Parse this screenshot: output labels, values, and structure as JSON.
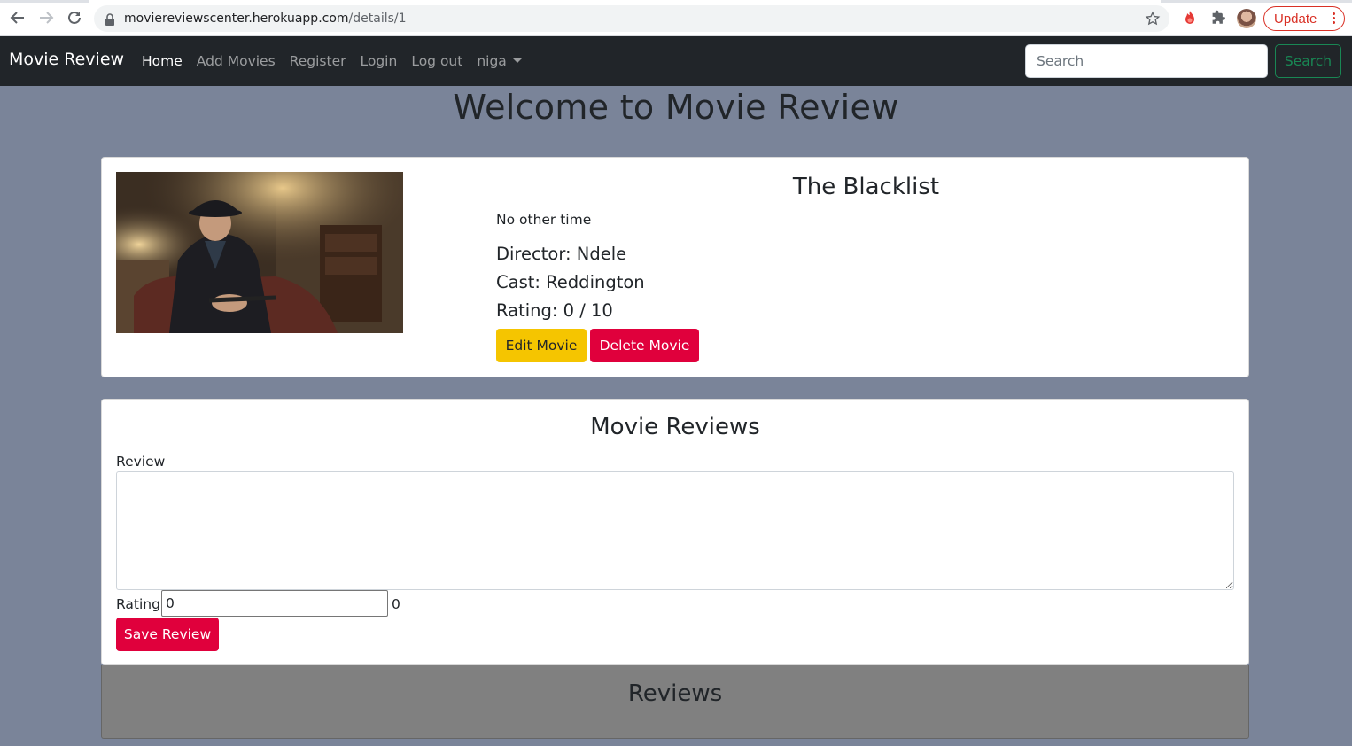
{
  "browser": {
    "url_host": "moviereviewscenter.herokuapp.com",
    "url_path": "/details/1",
    "update_label": "Update"
  },
  "navbar": {
    "brand": "Movie Review",
    "links": [
      "Home",
      "Add Movies",
      "Register",
      "Login",
      "Log out",
      "niga"
    ],
    "active_link": "Home",
    "search_placeholder": "Search",
    "search_button": "Search"
  },
  "page": {
    "title": "Welcome to Movie Review"
  },
  "movie": {
    "title": "The Blacklist",
    "description": "No other time",
    "director": "Director: Ndele",
    "cast": "Cast: Reddington",
    "rating": "Rating: 0 / 10",
    "edit_button": "Edit Movie",
    "delete_button": "Delete Movie"
  },
  "review_form": {
    "heading": "Movie Reviews",
    "review_label": "Review",
    "review_value": "",
    "rating_label": "Rating",
    "rating_value": "0",
    "rating_output": "0",
    "save_button": "Save Review"
  },
  "reviews_list": {
    "heading": "Reviews"
  },
  "colors": {
    "navbar_bg": "#212529",
    "page_bg": "#7a8499",
    "edit_button": "#f5c500",
    "danger_button": "#e0003c",
    "search_outline": "#198754",
    "reviews_list_bg": "#808080"
  }
}
